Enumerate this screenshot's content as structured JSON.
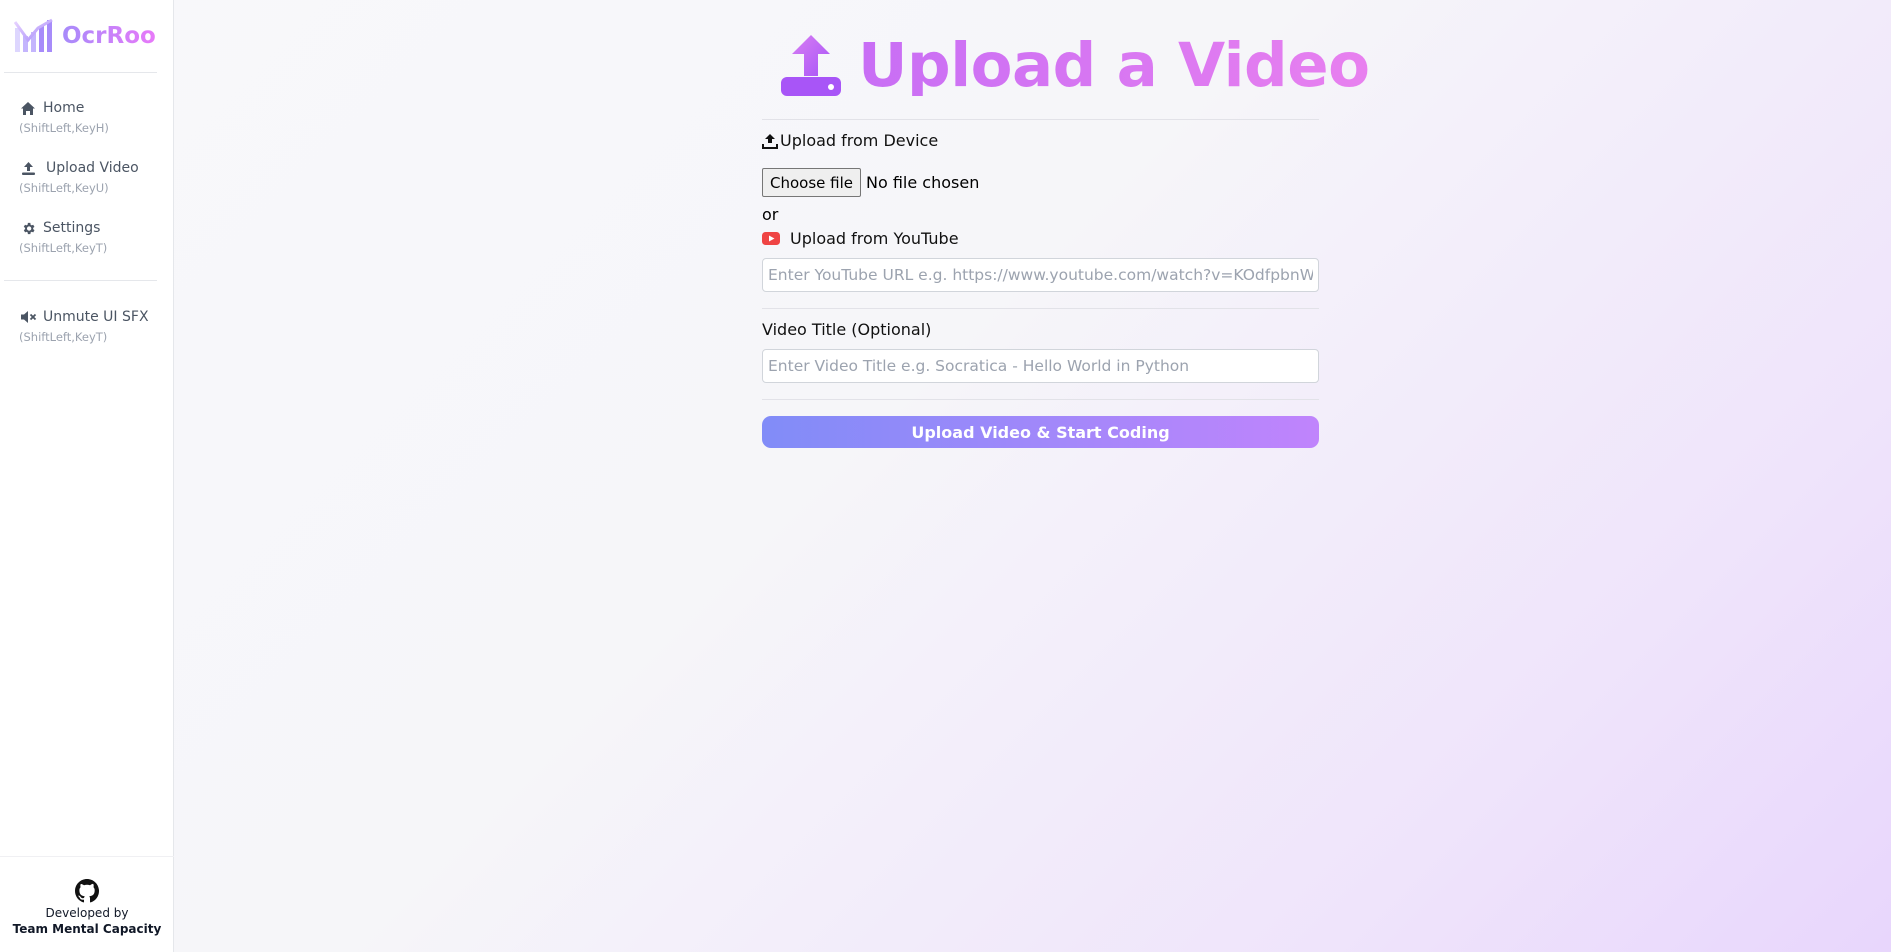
{
  "brand": {
    "name": "OcrRoo"
  },
  "sidebar": {
    "items": [
      {
        "label": "Home",
        "hint": "(ShiftLeft,KeyH)",
        "icon": "home-icon"
      },
      {
        "label": "Upload Video",
        "hint": "(ShiftLeft,KeyU)",
        "icon": "upload-icon"
      },
      {
        "label": "Settings",
        "hint": "(ShiftLeft,KeyT)",
        "icon": "gear-icon"
      }
    ],
    "sound": {
      "label": "Unmute UI SFX",
      "hint": "(ShiftLeft,KeyT)",
      "icon": "speaker-muted-icon"
    },
    "footer": {
      "developed_by": "Developed by",
      "team": "Team Mental Capacity",
      "icon": "github-icon"
    }
  },
  "main": {
    "title": "Upload a Video",
    "device": {
      "label": "Upload from Device",
      "button": "Choose file",
      "status": "No file chosen"
    },
    "or_text": "or",
    "youtube": {
      "label": "Upload from YouTube",
      "placeholder": "Enter YouTube URL e.g. https://www.youtube.com/watch?v=KOdfpbnWLVo"
    },
    "video_title": {
      "label": "Video Title (Optional)",
      "placeholder": "Enter Video Title e.g. Socratica - Hello World in Python"
    },
    "submit_label": "Upload Video & Start Coding"
  },
  "colors": {
    "accent_start": "#818cf8",
    "accent_end": "#c084fc",
    "title": "#d97ef2",
    "youtube_red": "#ef4444"
  }
}
